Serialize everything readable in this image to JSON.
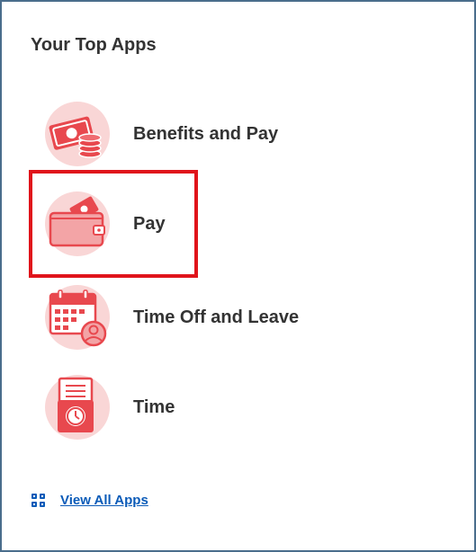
{
  "card": {
    "title": "Your Top Apps"
  },
  "apps": [
    {
      "label": "Benefits and Pay",
      "icon": "money-coins-icon"
    },
    {
      "label": "Pay",
      "icon": "wallet-icon"
    },
    {
      "label": "Time Off and Leave",
      "icon": "calendar-person-icon"
    },
    {
      "label": "Time",
      "icon": "timesheet-clock-icon"
    }
  ],
  "highlight": {
    "target": "Pay",
    "color": "#e0141b"
  },
  "footer": {
    "view_all_label": "View All Apps",
    "icon": "grid-icon"
  },
  "colors": {
    "icon_bg": "#f9d6d6",
    "icon_primary": "#e8484e",
    "link": "#0b5bb8",
    "border": "#4a6d8c"
  }
}
